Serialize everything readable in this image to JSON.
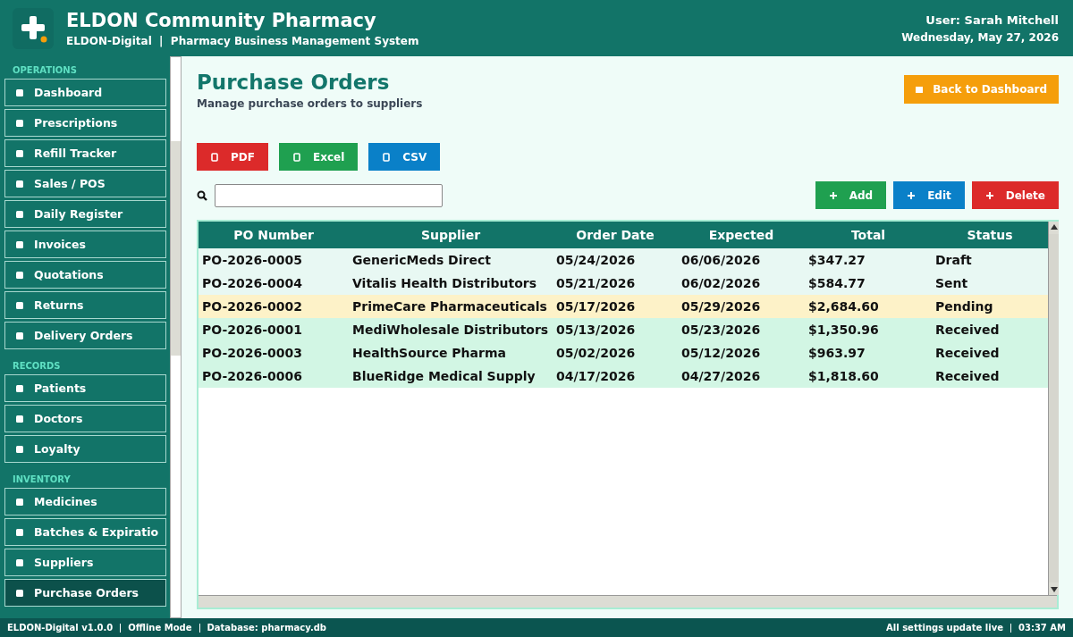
{
  "header": {
    "title": "ELDON Community Pharmacy",
    "subtitle": "ELDON-Digital  |  Pharmacy Business Management System",
    "user": "User: Sarah Mitchell",
    "date": "Wednesday, May 27, 2026"
  },
  "sidebar": {
    "sections": [
      {
        "title": "OPERATIONS",
        "items": [
          {
            "label": "Dashboard",
            "selected": false
          },
          {
            "label": "Prescriptions",
            "selected": false
          },
          {
            "label": "Refill Tracker",
            "selected": false
          },
          {
            "label": "Sales / POS",
            "selected": false
          },
          {
            "label": "Daily Register",
            "selected": false
          },
          {
            "label": "Invoices",
            "selected": false
          },
          {
            "label": "Quotations",
            "selected": false
          },
          {
            "label": "Returns",
            "selected": false
          },
          {
            "label": "Delivery Orders",
            "selected": false
          }
        ]
      },
      {
        "title": "RECORDS",
        "items": [
          {
            "label": "Patients",
            "selected": false
          },
          {
            "label": "Doctors",
            "selected": false
          },
          {
            "label": "Loyalty",
            "selected": false
          }
        ]
      },
      {
        "title": "INVENTORY",
        "items": [
          {
            "label": "Medicines",
            "selected": false
          },
          {
            "label": "Batches & Expiratio",
            "selected": false
          },
          {
            "label": "Suppliers",
            "selected": false
          },
          {
            "label": "Purchase Orders",
            "selected": true
          }
        ]
      }
    ]
  },
  "page": {
    "title": "Purchase Orders",
    "subtitle": "Manage purchase orders to suppliers",
    "back_button": "Back to Dashboard"
  },
  "export_buttons": [
    {
      "label": "PDF",
      "color": "#dc2a2a"
    },
    {
      "label": "Excel",
      "color": "#1fa050"
    },
    {
      "label": "CSV",
      "color": "#0a80c8"
    }
  ],
  "actions": [
    {
      "label": "Add",
      "color": "#1fa050"
    },
    {
      "label": "Edit",
      "color": "#0a80c8"
    },
    {
      "label": "Delete",
      "color": "#dc2a2a"
    }
  ],
  "table": {
    "columns": [
      "PO Number",
      "Supplier",
      "Order Date",
      "Expected",
      "Total",
      "Status"
    ],
    "rows": [
      {
        "cells": [
          "PO-2026-0005",
          "GenericMeds Direct",
          "05/24/2026",
          "06/06/2026",
          "$347.27",
          "Draft"
        ],
        "color": "#e8f8f3"
      },
      {
        "cells": [
          "PO-2026-0004",
          "Vitalis Health Distributors",
          "05/21/2026",
          "06/02/2026",
          "$584.77",
          "Sent"
        ],
        "color": "#e8f8f3"
      },
      {
        "cells": [
          "PO-2026-0002",
          "PrimeCare Pharmaceuticals",
          "05/17/2026",
          "05/29/2026",
          "$2,684.60",
          "Pending"
        ],
        "color": "#fdf2c8"
      },
      {
        "cells": [
          "PO-2026-0001",
          "MediWholesale Distributors",
          "05/13/2026",
          "05/23/2026",
          "$1,350.96",
          "Received"
        ],
        "color": "#d2f6e4"
      },
      {
        "cells": [
          "PO-2026-0003",
          "HealthSource Pharma",
          "05/02/2026",
          "05/12/2026",
          "$963.97",
          "Received"
        ],
        "color": "#d2f6e4"
      },
      {
        "cells": [
          "PO-2026-0006",
          "BlueRidge Medical Supply",
          "04/17/2026",
          "04/27/2026",
          "$1,818.60",
          "Received"
        ],
        "color": "#d2f6e4"
      }
    ]
  },
  "status_bar": {
    "left": [
      "ELDON-Digital v1.0.0",
      "Offline Mode",
      "Database: pharmacy.db"
    ],
    "right": [
      "All settings update live",
      "03:37 AM"
    ]
  }
}
